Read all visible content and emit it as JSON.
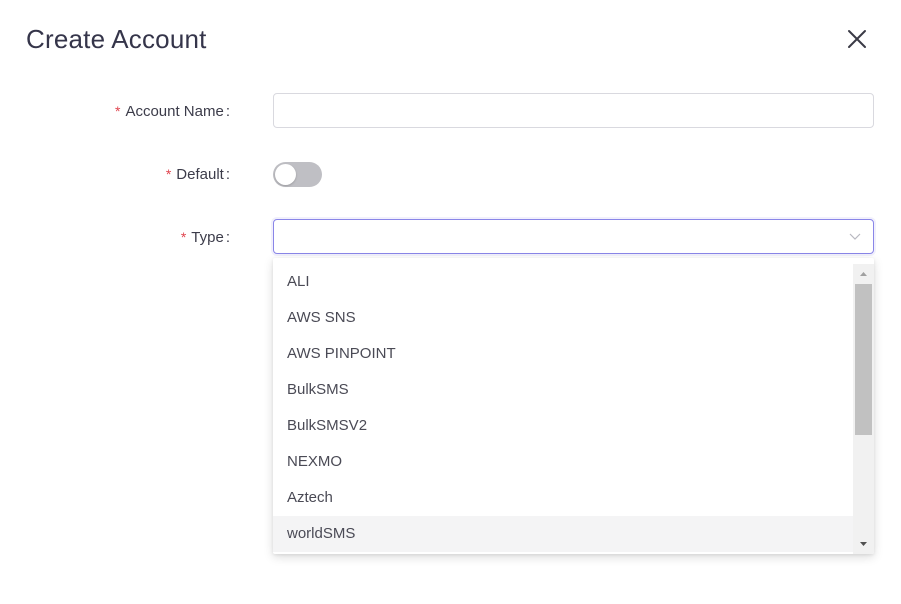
{
  "dialog": {
    "title": "Create Account",
    "close_icon": "close-icon"
  },
  "form": {
    "required_marker": "*",
    "account_name": {
      "label": "Account Name",
      "value": "",
      "placeholder": ""
    },
    "default": {
      "label": "Default",
      "enabled": false
    },
    "type": {
      "label": "Type",
      "value": "",
      "arrow_icon": "chevron-down-icon"
    },
    "colon": ":"
  },
  "dropdown": {
    "options": [
      "ALI",
      "AWS SNS",
      "AWS PINPOINT",
      "BulkSMS",
      "BulkSMSV2",
      "NEXMO",
      "Aztech",
      "worldSMS"
    ],
    "hovered_option": "worldSMS",
    "scroll_position_fraction": 0.0
  },
  "colors": {
    "title": "#35354a",
    "required": "#e0454f",
    "focus_border": "#8a86e8",
    "toggle_off": "#bfbfc4",
    "hover_bg": "#f4f4f5"
  }
}
